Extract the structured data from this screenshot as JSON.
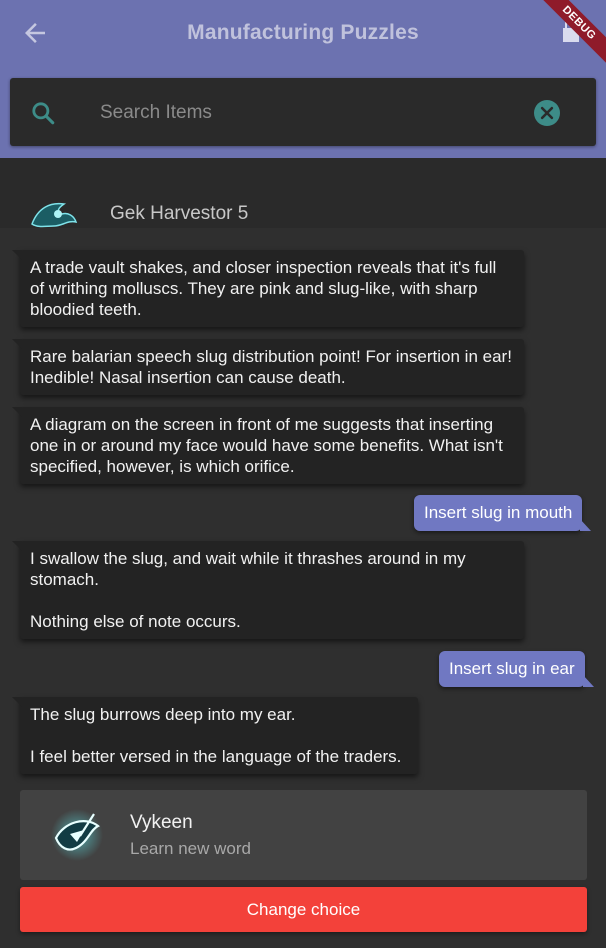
{
  "appbar": {
    "title": "Manufacturing Puzzles",
    "back_icon": "arrow-left-icon",
    "debug_label": "DEBUG",
    "bg_color": "#6c72b0"
  },
  "search": {
    "placeholder": "Search Items",
    "value": "",
    "icon": "search-icon",
    "clear_icon": "clear-icon",
    "icon_color": "#3d8c88"
  },
  "background_list": {
    "item_name": "Gek Harvestor 5"
  },
  "conversation": [
    {
      "type": "npc",
      "text": "A trade vault shakes, and closer inspection reveals that it's full of writhing molluscs. They are pink and slug-like, with sharp bloodied teeth."
    },
    {
      "type": "npc",
      "text": "Rare balarian speech slug distribution point! For insertion in ear! Inedible! Nasal insertion can cause death."
    },
    {
      "type": "npc",
      "text": "A diagram on the screen in front of me suggests that inserting one in or around my face would have some benefits. What isn't specified, however, is which orifice."
    },
    {
      "type": "player",
      "text": "Insert slug in mouth"
    },
    {
      "type": "npc",
      "text": "I swallow the slug, and wait while it thrashes around in my stomach.\n\nNothing else of note occurs."
    },
    {
      "type": "player",
      "text": "Insert slug in ear"
    },
    {
      "type": "npc",
      "text": "The slug burrows deep into my ear.\n\nI feel better versed in the language of the traders."
    }
  ],
  "reward": {
    "title": "Vykeen",
    "subtitle": "Learn new word",
    "icon": "vykeen-emblem-icon"
  },
  "change_choice_label": "Change choice",
  "accent_colors": {
    "player_bubble": "#7078c2",
    "change_button": "#f3413a"
  }
}
